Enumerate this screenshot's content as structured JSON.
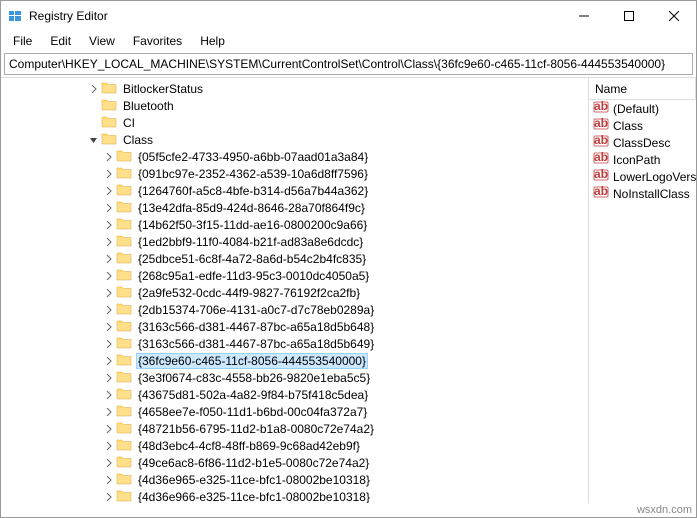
{
  "window": {
    "title": "Registry Editor"
  },
  "menu": {
    "file": "File",
    "edit": "Edit",
    "view": "View",
    "favorites": "Favorites",
    "help": "Help"
  },
  "address": {
    "path": "Computer\\HKEY_LOCAL_MACHINE\\SYSTEM\\CurrentControlSet\\Control\\Class\\{36fc9e60-c465-11cf-8056-444553540000}"
  },
  "tree": {
    "top": [
      {
        "indent": 85,
        "expander": "›",
        "label": "BitlockerStatus"
      },
      {
        "indent": 85,
        "expander": "",
        "label": "Bluetooth"
      },
      {
        "indent": 85,
        "expander": "",
        "label": "CI"
      },
      {
        "indent": 85,
        "expander": "v",
        "label": "Class"
      }
    ],
    "guids": [
      "{05f5cfe2-4733-4950-a6bb-07aad01a3a84}",
      "{091bc97e-2352-4362-a539-10a6d8ff7596}",
      "{1264760f-a5c8-4bfe-b314-d56a7b44a362}",
      "{13e42dfa-85d9-424d-8646-28a70f864f9c}",
      "{14b62f50-3f15-11dd-ae16-0800200c9a66}",
      "{1ed2bbf9-11f0-4084-b21f-ad83a8e6dcdc}",
      "{25dbce51-6c8f-4a72-8a6d-b54c2b4fc835}",
      "{268c95a1-edfe-11d3-95c3-0010dc4050a5}",
      "{2a9fe532-0cdc-44f9-9827-76192f2ca2fb}",
      "{2db15374-706e-4131-a0c7-d7c78eb0289a}",
      "{3163c566-d381-4467-87bc-a65a18d5b648}",
      "{3163c566-d381-4467-87bc-a65a18d5b649}",
      "{36fc9e60-c465-11cf-8056-444553540000}",
      "{3e3f0674-c83c-4558-bb26-9820e1eba5c5}",
      "{43675d81-502a-4a82-9f84-b75f418c5dea}",
      "{4658ee7e-f050-11d1-b6bd-00c04fa372a7}",
      "{48721b56-6795-11d2-b1a8-0080c72e74a2}",
      "{48d3ebc4-4cf8-48ff-b869-9c68ad42eb9f}",
      "{49ce6ac8-6f86-11d2-b1e5-0080c72e74a2}",
      "{4d36e965-e325-11ce-bfc1-08002be10318}",
      "{4d36e966-e325-11ce-bfc1-08002be10318}"
    ],
    "selectedGuid": "{36fc9e60-c465-11cf-8056-444553540000}"
  },
  "values": {
    "header": {
      "name": "Name"
    },
    "items": [
      "(Default)",
      "Class",
      "ClassDesc",
      "IconPath",
      "LowerLogoVersi",
      "NoInstallClass"
    ]
  },
  "watermark": "wsxdn.com"
}
